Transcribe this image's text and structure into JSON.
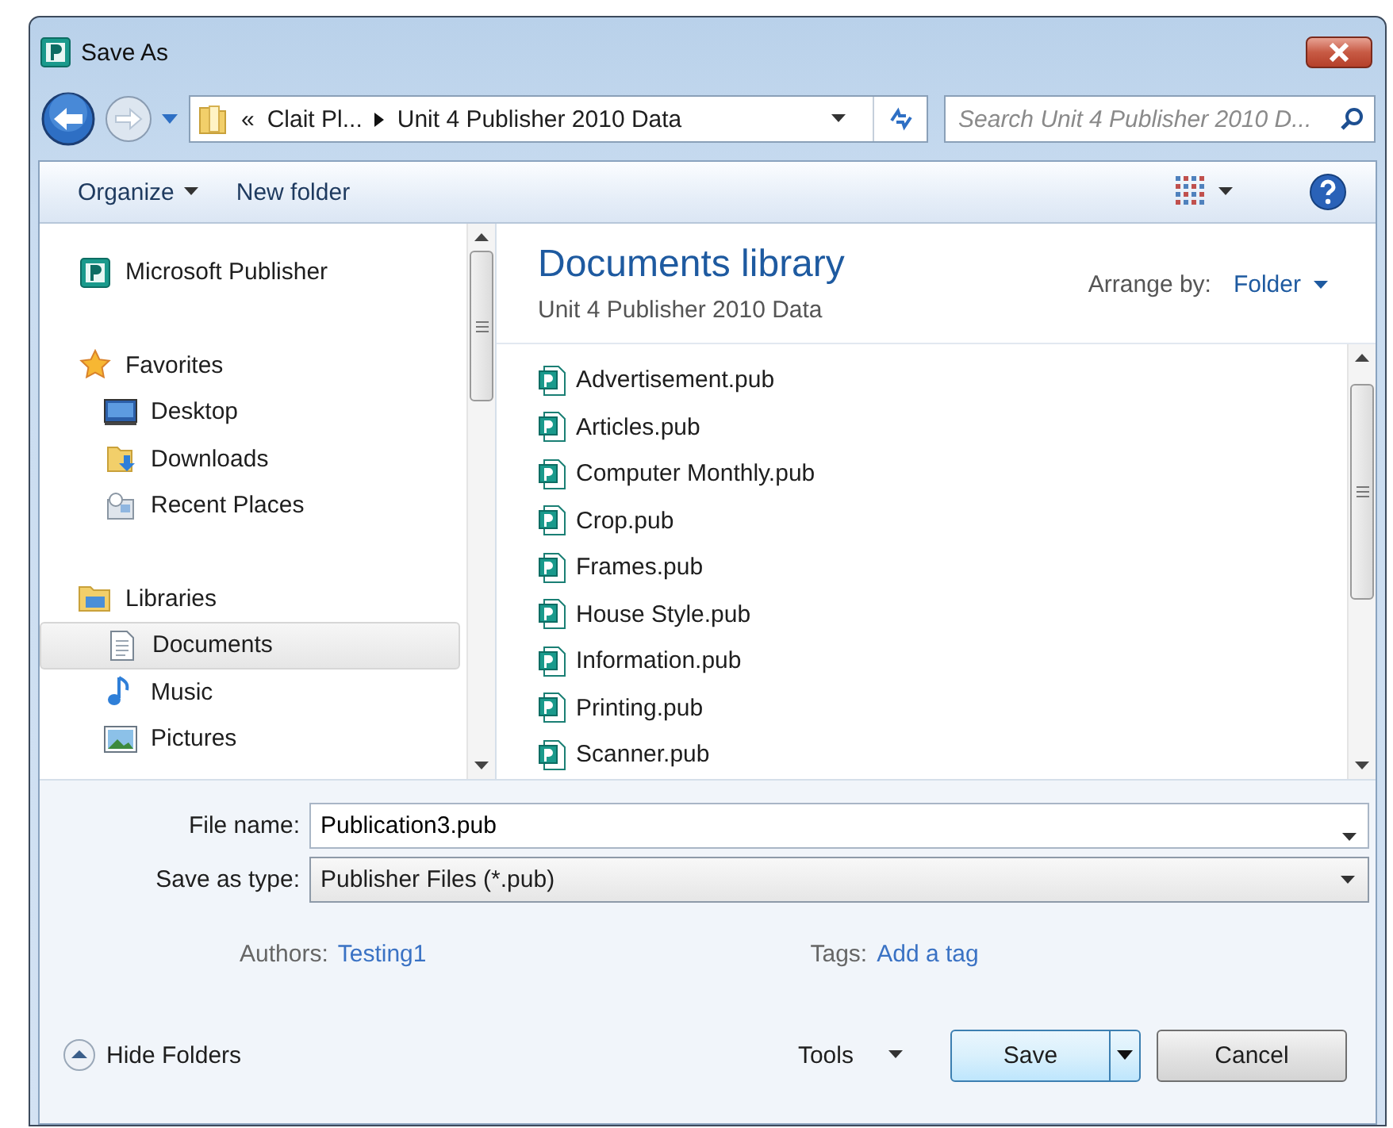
{
  "window": {
    "title": "Save As"
  },
  "address": {
    "segments": [
      "«",
      "Clait Pl...",
      "Unit 4 Publisher 2010 Data"
    ]
  },
  "search": {
    "placeholder": "Search Unit 4 Publisher 2010 D..."
  },
  "toolbar": {
    "organize": "Organize",
    "new_folder": "New folder"
  },
  "sidebar": {
    "sections": [
      {
        "label": "Microsoft Publisher",
        "kind": "publisher",
        "selected": false
      },
      {
        "label": "Favorites",
        "kind": "star",
        "selected": false,
        "children": [
          {
            "label": "Desktop",
            "kind": "desktop",
            "selected": false
          },
          {
            "label": "Downloads",
            "kind": "downloads",
            "selected": false
          },
          {
            "label": "Recent Places",
            "kind": "recent",
            "selected": false
          }
        ]
      },
      {
        "label": "Libraries",
        "kind": "libraries",
        "selected": false,
        "children": [
          {
            "label": "Documents",
            "kind": "documents",
            "selected": true
          },
          {
            "label": "Music",
            "kind": "music",
            "selected": false
          },
          {
            "label": "Pictures",
            "kind": "pictures",
            "selected": false
          }
        ]
      }
    ]
  },
  "library": {
    "title": "Documents library",
    "subtitle": "Unit 4 Publisher 2010 Data",
    "arrange_label": "Arrange by:",
    "arrange_value": "Folder"
  },
  "files": [
    "Advertisement.pub",
    "Articles.pub",
    "Computer Monthly.pub",
    "Crop.pub",
    "Frames.pub",
    "House Style.pub",
    "Information.pub",
    "Printing.pub",
    "Scanner.pub"
  ],
  "form": {
    "file_name_label": "File name:",
    "file_name": "Publication3.pub",
    "type_label": "Save as type:",
    "type": "Publisher Files (*.pub)",
    "authors_label": "Authors:",
    "authors": "Testing1",
    "tags_label": "Tags:",
    "tags": "Add a tag"
  },
  "footer": {
    "hide_folders": "Hide Folders",
    "tools": "Tools",
    "save": "Save",
    "cancel": "Cancel"
  }
}
